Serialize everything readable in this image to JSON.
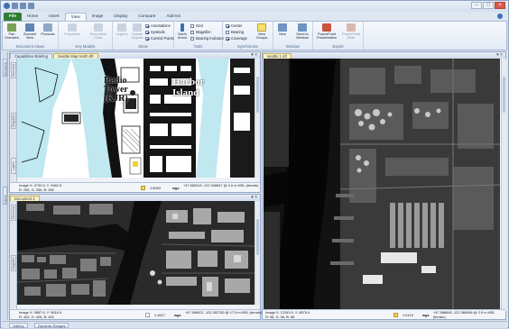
{
  "ribbon": {
    "tabs": [
      "File",
      "Home",
      "Insert",
      "View",
      "Image",
      "Display",
      "Compare",
      "Add-ins"
    ],
    "active_tab": "View",
    "groups": {
      "document_views": {
        "label": "Document Views",
        "buttons": [
          "Pan Overview",
          "Zoomed View",
          "Products"
        ]
      },
      "key_models": {
        "label": "Key Models",
        "buttons": [
          "Properties",
          "Resolution Chart"
        ]
      },
      "show": {
        "label": "Show",
        "buttons": [
          "Legend",
          "Hidden Objects"
        ],
        "checkboxes": [
          {
            "label": "Annotations",
            "checked": true
          },
          {
            "label": "Symbols",
            "checked": true
          },
          {
            "label": "Control Points",
            "checked": true
          }
        ]
      },
      "tools": {
        "label": "Tools",
        "buttons": [
          "North Arrow"
        ],
        "checkboxes": [
          {
            "label": "Grid",
            "checked": false
          },
          {
            "label": "Magnifier",
            "checked": false
          },
          {
            "label": "Bearing Indicator",
            "checked": false
          }
        ]
      },
      "synchronize": {
        "label": "Synchronize",
        "checkboxes": [
          {
            "label": "Center",
            "checked": true
          },
          {
            "label": "Bearing",
            "checked": false
          },
          {
            "label": "Coverage",
            "checked": true
          }
        ],
        "buttons": [
          "View Groups"
        ]
      },
      "window": {
        "label": "Window",
        "buttons": [
          "New",
          "Send to Window"
        ]
      },
      "export": {
        "label": "Export",
        "buttons": [
          "PowerPoint Presentation",
          "PowerPoint Slide"
        ]
      }
    }
  },
  "panes": {
    "top_left": {
      "tabs": [
        "Capabilities Briefing",
        "Seattle Map North 5ft"
      ],
      "active_tab": 1,
      "map_labels": [
        "Radio Tower (KJR)",
        "Harbor Island"
      ],
      "status": {
        "image_coords": "Image X: 4732.5, Y: 2062.5",
        "pixel_values": "R: 255, G: 255, B: 255",
        "scale": "1:8063",
        "datum": "wgs",
        "geo": "+47.582518 -122.348847 @ 0.0 m MSL (terrain)"
      }
    },
    "bottom_left": {
      "tabs": [
        "Document 3"
      ],
      "active_tab": 0,
      "status": {
        "image_coords": "Image X: 3687.9, Y: 5616.9",
        "pixel_values": "R: 425, G: 425, B: 425",
        "scale": "1:1617",
        "datum": "wgs",
        "geo": "+47.569521 -122.352783 @ 17.9 m MSL (terrain)"
      }
    },
    "right": {
      "tabs": [
        "seattle 1.ntf"
      ],
      "active_tab": 0,
      "status": {
        "image_coords": "Image X: 12343.9, Y: 8575.4",
        "pixel_values": "R: 98, G: 98, B: 98",
        "scale": "1:2419",
        "datum": "wgs",
        "geo": "+47.588845 -122.368408 @ 2.9 m MSL (terrain)"
      }
    }
  },
  "side_tabs": [
    "Document Views",
    "Layers",
    "Overview",
    "Magnifier"
  ],
  "bottom_tabs": [
    "Gallery",
    "Dynamic Ranges"
  ],
  "colors": {
    "file_tab": "#2f7d32",
    "accent": "#3a6fb2",
    "status_swatch": "#f6d84c"
  }
}
